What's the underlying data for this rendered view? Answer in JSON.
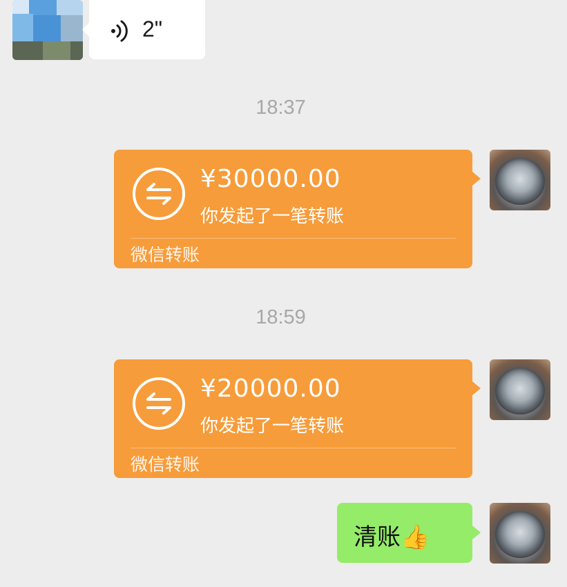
{
  "voice_message": {
    "duration": "2\"",
    "icon": "voice-wave-icon"
  },
  "timestamps": [
    "18:37",
    "18:59"
  ],
  "transfers": [
    {
      "amount": "¥30000.00",
      "description": "你发起了一笔转账",
      "footer": "微信转账",
      "icon": "transfer-arrows-icon"
    },
    {
      "amount": "¥20000.00",
      "description": "你发起了一笔转账",
      "footer": "微信转账",
      "icon": "transfer-arrows-icon"
    }
  ],
  "text_message": {
    "text": "清账👍"
  },
  "colors": {
    "background": "#ededed",
    "transfer_card": "#f79c3a",
    "sent_bubble": "#95ec69",
    "received_bubble": "#ffffff",
    "timestamp": "#a7a7a7"
  }
}
